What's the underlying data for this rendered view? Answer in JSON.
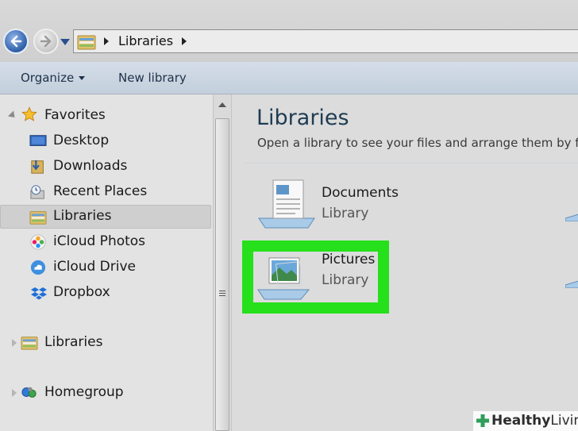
{
  "address_bar": {
    "path": [
      "Libraries"
    ]
  },
  "toolbar": {
    "organize_label": "Organize",
    "new_library_label": "New library"
  },
  "nav": {
    "favorites": {
      "label": "Favorites",
      "items": [
        {
          "label": "Desktop",
          "icon": "desktop-icon"
        },
        {
          "label": "Downloads",
          "icon": "downloads-icon"
        },
        {
          "label": "Recent Places",
          "icon": "recent-places-icon"
        },
        {
          "label": "Libraries",
          "icon": "libraries-icon",
          "selected": true
        },
        {
          "label": "iCloud Photos",
          "icon": "icloud-photos-icon"
        },
        {
          "label": "iCloud Drive",
          "icon": "icloud-drive-icon"
        },
        {
          "label": "Dropbox",
          "icon": "dropbox-icon"
        }
      ]
    },
    "libraries": {
      "label": "Libraries"
    },
    "homegroup": {
      "label": "Homegroup"
    }
  },
  "content": {
    "title": "Libraries",
    "subtitle": "Open a library to see your files and arrange them by folde",
    "libraries": [
      {
        "name": "Documents",
        "type": "Library",
        "icon": "documents-library-icon"
      },
      {
        "name": "Pictures",
        "type": "Library",
        "icon": "pictures-library-icon",
        "highlighted": true
      }
    ]
  },
  "watermark": {
    "brand_a": "Healthy",
    "brand_b": "Living"
  },
  "colors": {
    "highlight": "#25e01b",
    "title": "#1f3c52",
    "toolbar": "#c9d4e0"
  }
}
